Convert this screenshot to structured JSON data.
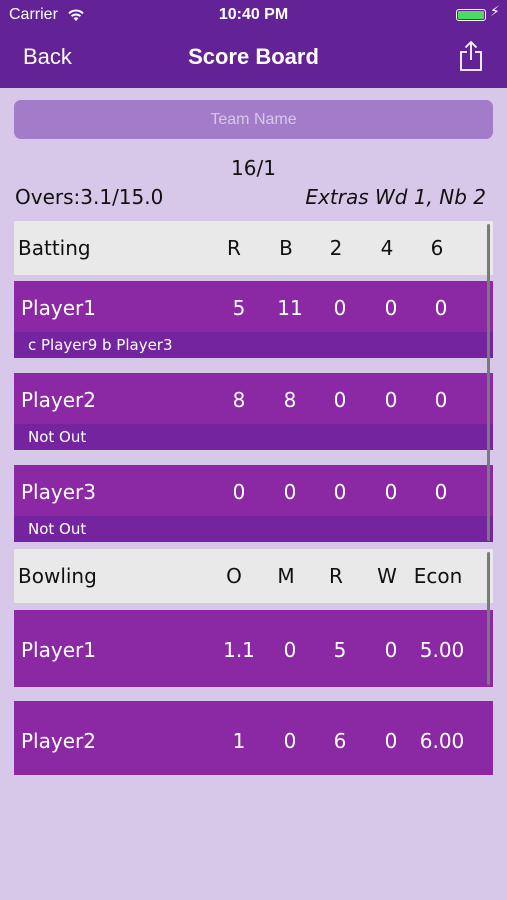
{
  "status": {
    "carrier": "Carrier",
    "time": "10:40 PM"
  },
  "nav": {
    "back": "Back",
    "title": "Score Board"
  },
  "team_field": {
    "placeholder": "Team Name",
    "value": ""
  },
  "summary": {
    "score": "16/1",
    "overs": "Overs:3.1/15.0",
    "extras": "Extras Wd 1, Nb 2"
  },
  "batting": {
    "header": {
      "label": "Batting",
      "cols": [
        "R",
        "B",
        "2",
        "4",
        "6"
      ]
    },
    "rows": [
      {
        "name": "Player1",
        "vals": [
          "5",
          "11",
          "0",
          "0",
          "0"
        ],
        "status": "c Player9  b Player3"
      },
      {
        "name": "Player2",
        "vals": [
          "8",
          "8",
          "0",
          "0",
          "0"
        ],
        "status": "Not Out"
      },
      {
        "name": "Player3",
        "vals": [
          "0",
          "0",
          "0",
          "0",
          "0"
        ],
        "status": "Not Out"
      }
    ]
  },
  "bowling": {
    "header": {
      "label": "Bowling",
      "cols": [
        "O",
        "M",
        "R",
        "W",
        "Econ"
      ]
    },
    "rows": [
      {
        "name": "Player1",
        "vals": [
          "1.1",
          "0",
          "5",
          "0",
          "5.00"
        ]
      },
      {
        "name": "Player2",
        "vals": [
          "1",
          "0",
          "6",
          "0",
          "6.00"
        ]
      }
    ]
  },
  "colors": {
    "nav": "#632295",
    "row": "#8b29a5",
    "sub_row": "#7524a0",
    "background": "#d7c8e9",
    "header": "#e9e9e9"
  }
}
